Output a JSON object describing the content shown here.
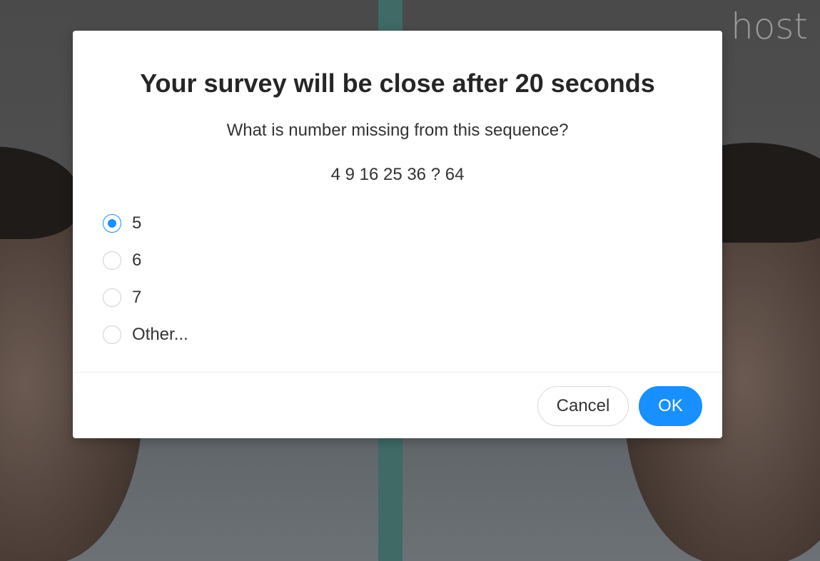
{
  "app": {
    "host_label": "host"
  },
  "modal": {
    "title": "Your survey will be close after 20 seconds",
    "question": "What is number missing from this sequence?",
    "sequence": "4 9 16 25 36 ? 64",
    "options": [
      {
        "label": "5",
        "selected": true
      },
      {
        "label": "6",
        "selected": false
      },
      {
        "label": "7",
        "selected": false
      },
      {
        "label": "Other...",
        "selected": false
      }
    ],
    "cancel_label": "Cancel",
    "ok_label": "OK"
  },
  "colors": {
    "accent": "#1890ff",
    "divider_bar": "#3f6a66",
    "host_text": "#9a9a9a"
  }
}
